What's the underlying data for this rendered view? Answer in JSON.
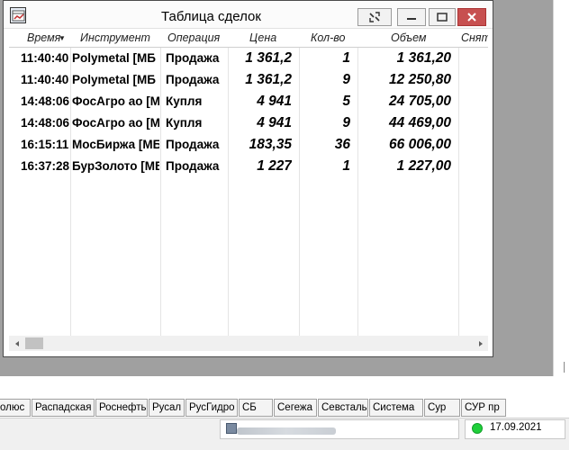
{
  "window": {
    "title": "Таблица сделок"
  },
  "table": {
    "columns": [
      "Время",
      "Инструмент",
      "Операция",
      "Цена",
      "Кол-во",
      "Объем",
      "Снят"
    ],
    "sort_indicator": "▼",
    "rows": [
      {
        "time": "11:40:40",
        "instrument": "Polymetal [МБ",
        "operation": "Продажа",
        "price": "1 361,2",
        "qty": "1",
        "volume": "1 361,20"
      },
      {
        "time": "11:40:40",
        "instrument": "Polymetal [МБ",
        "operation": "Продажа",
        "price": "1 361,2",
        "qty": "9",
        "volume": "12 250,80"
      },
      {
        "time": "14:48:06",
        "instrument": "ФосАгро ао [М",
        "operation": "Купля",
        "price": "4 941",
        "qty": "5",
        "volume": "24 705,00"
      },
      {
        "time": "14:48:06",
        "instrument": "ФосАгро ао [М",
        "operation": "Купля",
        "price": "4 941",
        "qty": "9",
        "volume": "44 469,00"
      },
      {
        "time": "16:15:11",
        "instrument": "МосБиржа [МБ",
        "operation": "Продажа",
        "price": "183,35",
        "qty": "36",
        "volume": "66 006,00"
      },
      {
        "time": "16:37:28",
        "instrument": "БурЗолото [МБ",
        "operation": "Продажа",
        "price": "1 227",
        "qty": "1",
        "volume": "1 227,00"
      }
    ]
  },
  "tabs": [
    "олюс",
    "Распадская",
    "Роснефть",
    "Русал",
    "РусГидро",
    "СБ",
    "Сегежа",
    "Севсталь",
    "Система",
    "Сур",
    "СУР пр"
  ],
  "status": {
    "date": "17.09.2021",
    "connection_color": "#1fcf3a"
  }
}
